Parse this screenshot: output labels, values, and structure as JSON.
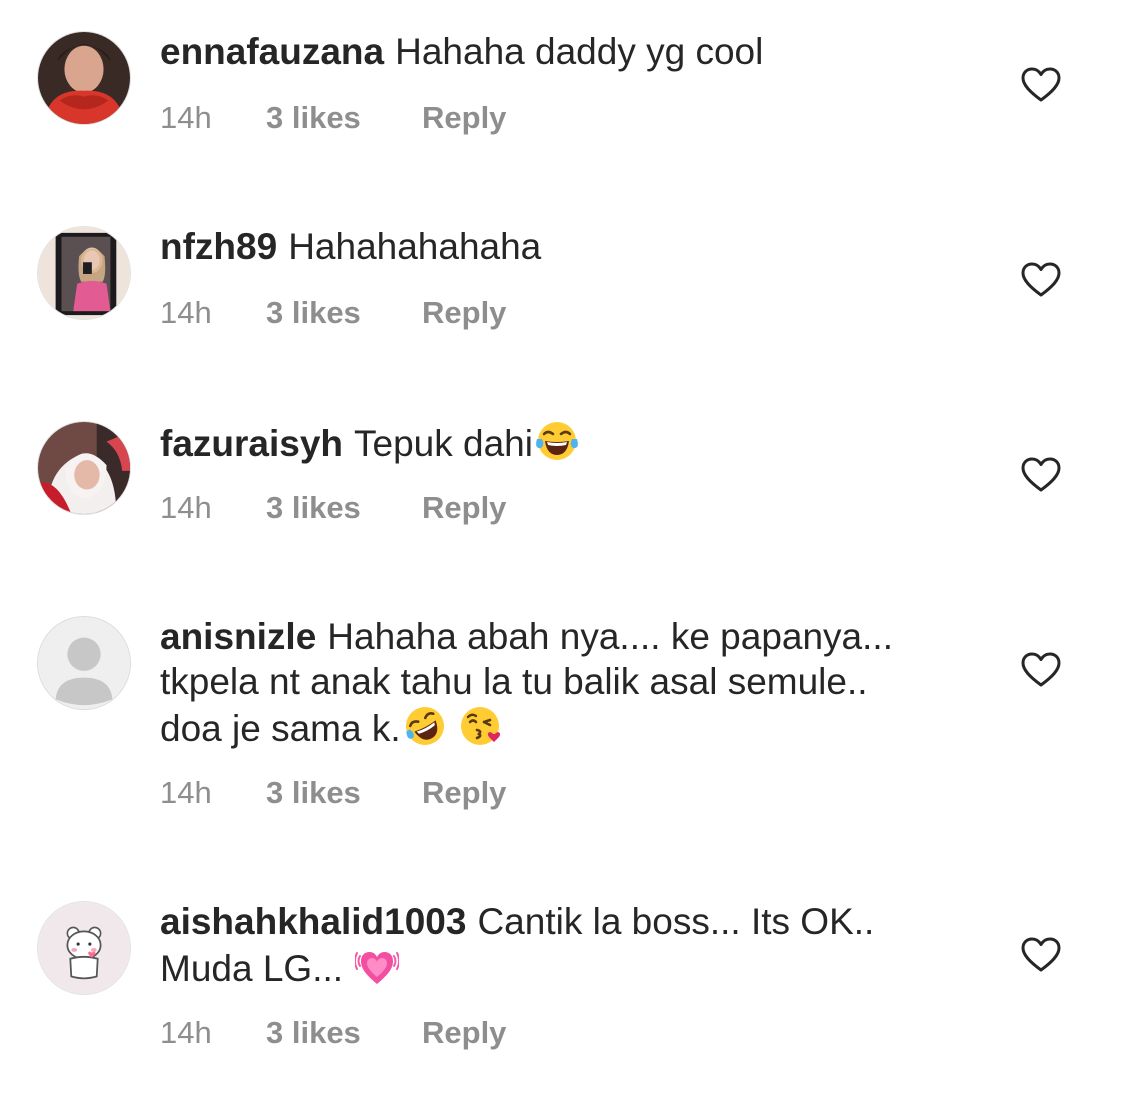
{
  "comments": [
    {
      "username": "ennafauzana",
      "text": "Hahaha daddy yg cool",
      "time": "14h",
      "likes": "3 likes",
      "reply": "Reply",
      "avatar": "profile-photo-woman-red-scarf",
      "heart_icon": "heart-outline-icon"
    },
    {
      "username": "nfzh89",
      "text": "Hahahahahaha",
      "time": "14h",
      "likes": "3 likes",
      "reply": "Reply",
      "avatar": "profile-photo-mirror-selfie",
      "heart_icon": "heart-outline-icon"
    },
    {
      "username": "fazuraisyh",
      "text": "Tepuk dahi",
      "emojis": [
        "face-with-tears-of-joy"
      ],
      "time": "14h",
      "likes": "3 likes",
      "reply": "Reply",
      "avatar": "profile-photo-woman-hijab",
      "heart_icon": "heart-outline-icon"
    },
    {
      "username": "anisnizle",
      "text_line1": "Hahaha abah nya.... ke papanya...",
      "text_line2": "tkpela nt anak tahu la tu balik asal semule..",
      "text_line3": "doa je sama k.",
      "emojis": [
        "rolling-on-floor-laughing",
        "face-blowing-kiss"
      ],
      "time": "14h",
      "likes": "3 likes",
      "reply": "Reply",
      "avatar": "default-profile-placeholder",
      "heart_icon": "heart-outline-icon"
    },
    {
      "username": "aishahkhalid1003",
      "text_line1": "Cantik la boss... Its OK..",
      "text_line2": "Muda LG...",
      "emojis": [
        "growing-heart"
      ],
      "time": "14h",
      "likes": "3 likes",
      "reply": "Reply",
      "avatar": "profile-cartoon-bear",
      "heart_icon": "heart-outline-icon"
    }
  ],
  "colors": {
    "text": "#262626",
    "meta": "#8e8e8e",
    "heart_stroke": "#262626"
  }
}
